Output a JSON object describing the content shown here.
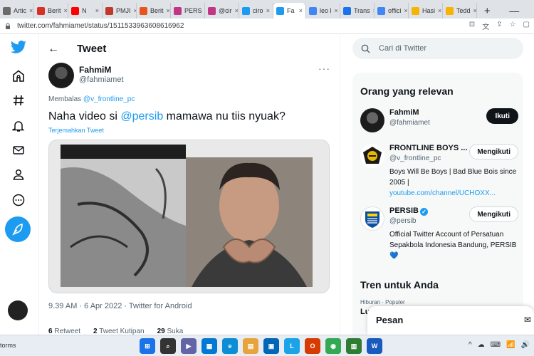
{
  "browser": {
    "tabs": [
      {
        "label": "Artic",
        "color": "#6b6b6b"
      },
      {
        "label": "Berit",
        "color": "#d93025"
      },
      {
        "label": "N",
        "color": "#ff0000"
      },
      {
        "label": "PMJI",
        "color": "#c0392b"
      },
      {
        "label": "Berit",
        "color": "#e8541e"
      },
      {
        "label": "PERS",
        "color": "#c13584"
      },
      {
        "label": "@cir",
        "color": "#c13584"
      },
      {
        "label": "ciro",
        "color": "#1d9bf0"
      },
      {
        "label": "Fa",
        "color": "#1d9bf0"
      },
      {
        "label": "leo l",
        "color": "#4285f4"
      },
      {
        "label": "Trans",
        "color": "#1a73e8"
      },
      {
        "label": "offici",
        "color": "#4285f4"
      },
      {
        "label": "Hasi",
        "color": "#f4b400"
      },
      {
        "label": "Tedd",
        "color": "#f4b400"
      }
    ],
    "active_tab_index": 8,
    "new_tab_symbol": "+",
    "url": "twitter.com/fahmiamet/status/1511533963608616962"
  },
  "tweet_page": {
    "header_title": "Tweet",
    "author_name": "FahmiM",
    "author_handle": "@fahmiamet",
    "reply_prefix": "Membalas",
    "reply_to": "@v_frontline_pc",
    "text_before": "Naha video si ",
    "text_mention": "@persib",
    "text_after": " mamawa nu tiis nyuak?",
    "translate_label": "Terjemahkan Tweet",
    "meta": "9.39 AM · 6 Apr 2022 · Twitter for Android",
    "stats": [
      {
        "count": "6",
        "label": "Retweet"
      },
      {
        "count": "2",
        "label": "Tweet Kutipan"
      },
      {
        "count": "29",
        "label": "Suka"
      }
    ]
  },
  "sidebar": {
    "search_placeholder": "Cari di Twitter",
    "relevant_title": "Orang yang relevan",
    "people": [
      {
        "name": "FahmiM",
        "handle": "@fahmiamet",
        "button": "Ikuti",
        "bio": "",
        "link": ""
      },
      {
        "name": "FRONTLINE BOYS ...",
        "handle": "@v_frontline_pc",
        "button": "Mengikuti",
        "bio": "Boys Will Be Boys | Bad Blue Bois since 2005 |",
        "link": "youtube.com/channel/UCHOXX..."
      },
      {
        "name": "PERSIB",
        "handle": "@persib",
        "button": "Mengikuti",
        "bio": "Official Twitter Account of Persatuan Sepakbola Indonesia Bandung, PERSIB 💙",
        "link": ""
      }
    ],
    "trends_title": "Tren untuk Anda",
    "trends_sub": "Hiburan · Populer",
    "trends_item": "Lu"
  },
  "messages": {
    "title": "Pesan"
  },
  "taskbar": {
    "left_text": "torms",
    "apps": [
      {
        "label": "⊞",
        "color": "#1a73e8"
      },
      {
        "label": "⌕",
        "color": "#333333"
      },
      {
        "label": "▶",
        "color": "#6264a7"
      },
      {
        "label": "▦",
        "color": "#0078d4"
      },
      {
        "label": "e",
        "color": "#0c8dd6"
      },
      {
        "label": "▤",
        "color": "#e8a33d"
      },
      {
        "label": "▣",
        "color": "#0067b8"
      },
      {
        "label": "L",
        "color": "#1aa3e8"
      },
      {
        "label": "O",
        "color": "#d83b01"
      },
      {
        "label": "◉",
        "color": "#34a853"
      },
      {
        "label": "▥",
        "color": "#2e7d32"
      },
      {
        "label": "W",
        "color": "#185abd"
      }
    ],
    "tray": [
      "^",
      "☁",
      "⌨",
      "📶",
      "🔊"
    ]
  }
}
